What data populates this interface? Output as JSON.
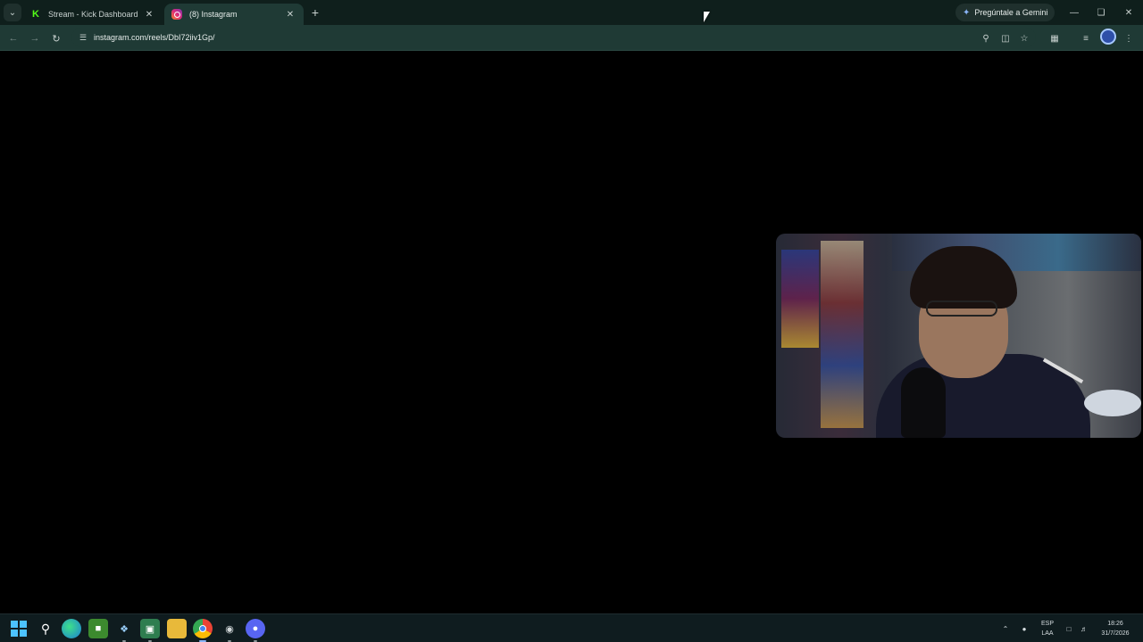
{
  "browser": {
    "tabs": [
      {
        "title": "Stream - Kick Dashboard",
        "icon": "kick-favicon",
        "active": false
      },
      {
        "title": "(8) Instagram",
        "icon": "instagram-favicon",
        "active": true
      }
    ],
    "gemini_label": "Pregúntale a Gemini",
    "url": "instagram.com/reels/DbI72iiv1Gp/"
  },
  "taskbar": {
    "apps": [
      "windows-start",
      "search",
      "edge",
      "minecraft",
      "app-5",
      "app-6",
      "file-explorer",
      "chrome",
      "app-9",
      "discord"
    ],
    "language_line1": "ESP",
    "language_line2": "LAA",
    "time": "18:26",
    "date": "31/7/2026"
  },
  "colors": {
    "tabstrip_bg": "#0f1f1c",
    "toolbar_bg": "#1f3a35",
    "content_bg": "#000000",
    "taskbar_bg": "#0f1c1f",
    "accent": "#8ab4f8"
  }
}
